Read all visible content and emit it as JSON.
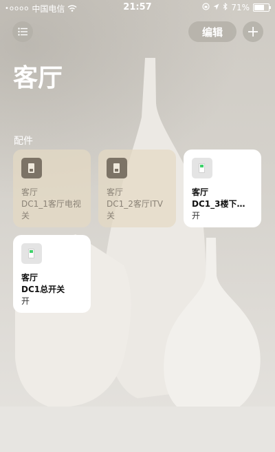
{
  "status_bar": {
    "signal_dots": "•oooo",
    "carrier": "中国电信",
    "time": "21:57",
    "battery": "71%",
    "battery_level": 0.71
  },
  "header": {
    "edit_label": "编辑",
    "room_title": "客厅"
  },
  "section_label": "配件",
  "accessories": [
    {
      "room": "客厅",
      "name": "DC1_1客厅电视",
      "state": "关"
    },
    {
      "room": "客厅",
      "name": "DC1_2客厅ITV",
      "state": "关"
    },
    {
      "room": "客厅",
      "name": "DC1_3楼下…",
      "state": "开"
    },
    {
      "room": "客厅",
      "name": "DC1总开关",
      "state": "开"
    }
  ],
  "colors": {
    "tile_on_bg": "#ffffff",
    "tile_off_bg": "#e4dac4",
    "switch_on_indicator": "#3fd16b"
  }
}
